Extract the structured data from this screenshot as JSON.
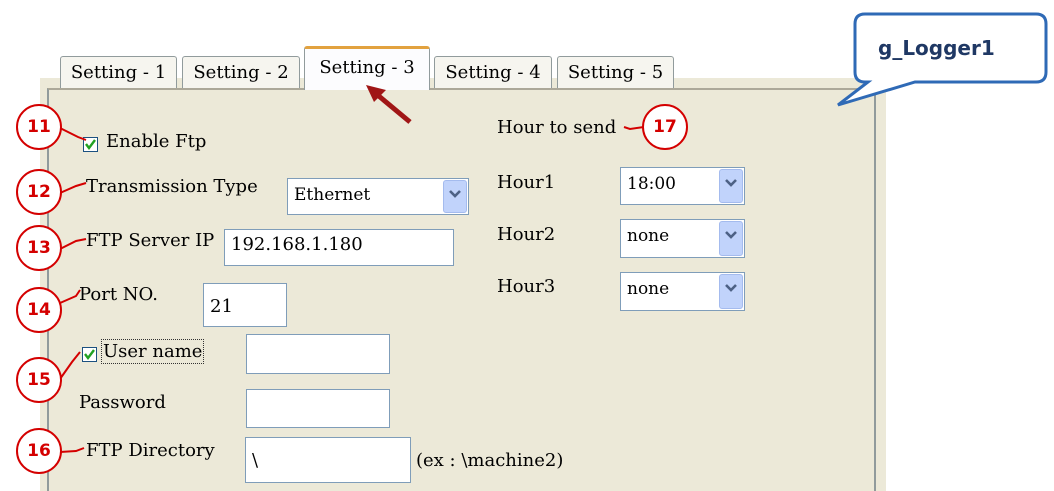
{
  "tabs": [
    "Setting - 1",
    "Setting - 2",
    "Setting - 3",
    "Setting - 4",
    "Setting - 5"
  ],
  "active_tab": "Setting - 3",
  "callout": {
    "label": "g_Logger1"
  },
  "left": {
    "enable_ftp": {
      "label": "Enable Ftp",
      "checked": true
    },
    "transmission_type": {
      "label": "Transmission Type",
      "value": "Ethernet"
    },
    "ftp_server_ip": {
      "label": "FTP Server IP",
      "value": "192.168.1.180"
    },
    "port": {
      "label": "Port NO.",
      "value": "21"
    },
    "user_name": {
      "label": "User name",
      "checked": true,
      "value": ""
    },
    "password": {
      "label": "Password",
      "value": ""
    },
    "ftp_directory": {
      "label": "FTP Directory",
      "value": "\\",
      "hint": "(ex : \\machine2)"
    }
  },
  "right": {
    "hour_to_send_label": "Hour to send",
    "hours": [
      {
        "label": "Hour1",
        "value": "18:00"
      },
      {
        "label": "Hour2",
        "value": "none"
      },
      {
        "label": "Hour3",
        "value": "none"
      }
    ]
  },
  "badges": [
    "11",
    "12",
    "13",
    "14",
    "15",
    "16",
    "17"
  ],
  "colors": {
    "badge_red": "#d40000",
    "callout_blue": "#2f6ab6",
    "active_tab_accent": "#e2a23f"
  }
}
